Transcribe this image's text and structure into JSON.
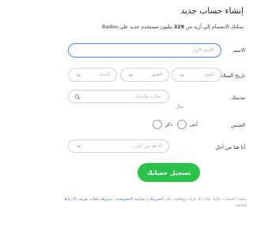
{
  "header": {
    "title": "إنشاء حساب جديد"
  },
  "intro": {
    "text_before": "يمكنك الانضمام إلى أزيد من ",
    "count": "329",
    "text_after": " مليون مستخدم جديد على Badoo."
  },
  "form": {
    "name": {
      "label": "الاسم",
      "placeholder": "الاسم الأول"
    },
    "birthday": {
      "label": "تاريخ الميلاد",
      "day": "اليوم",
      "month": "الشهر",
      "year": "السنة"
    },
    "city": {
      "label": "مدينتك",
      "placeholder": "مكان تواجدك",
      "example": "مثال:"
    },
    "gender": {
      "label": "الجنس",
      "male": "ذكر",
      "female": "أنثى"
    },
    "purpose": {
      "label": "أنا هنا من أجل",
      "placeholder": "أنا هنا من أجل..."
    },
    "submit": "تسجيل حسابك"
  },
  "terms": {
    "line1_pre": "بإنشاء الحساب، فإنك تؤكد أنك قرأت ووافقت على ",
    "terms_link": "الشروط",
    "line1_mid": " و ",
    "privacy_link": "سياسة الخصوصية",
    "line1_post": " - ",
    "cookies_link": "شروط ملفات تعريف الارتباط",
    "line2": "الخاصة"
  },
  "colors": {
    "accent_green": "#2bc24a",
    "focus_blue": "#5a8cf0",
    "link_blue": "#5a86d0"
  },
  "icons": {
    "chevron": "chevron-down-icon",
    "search": "search-icon"
  }
}
